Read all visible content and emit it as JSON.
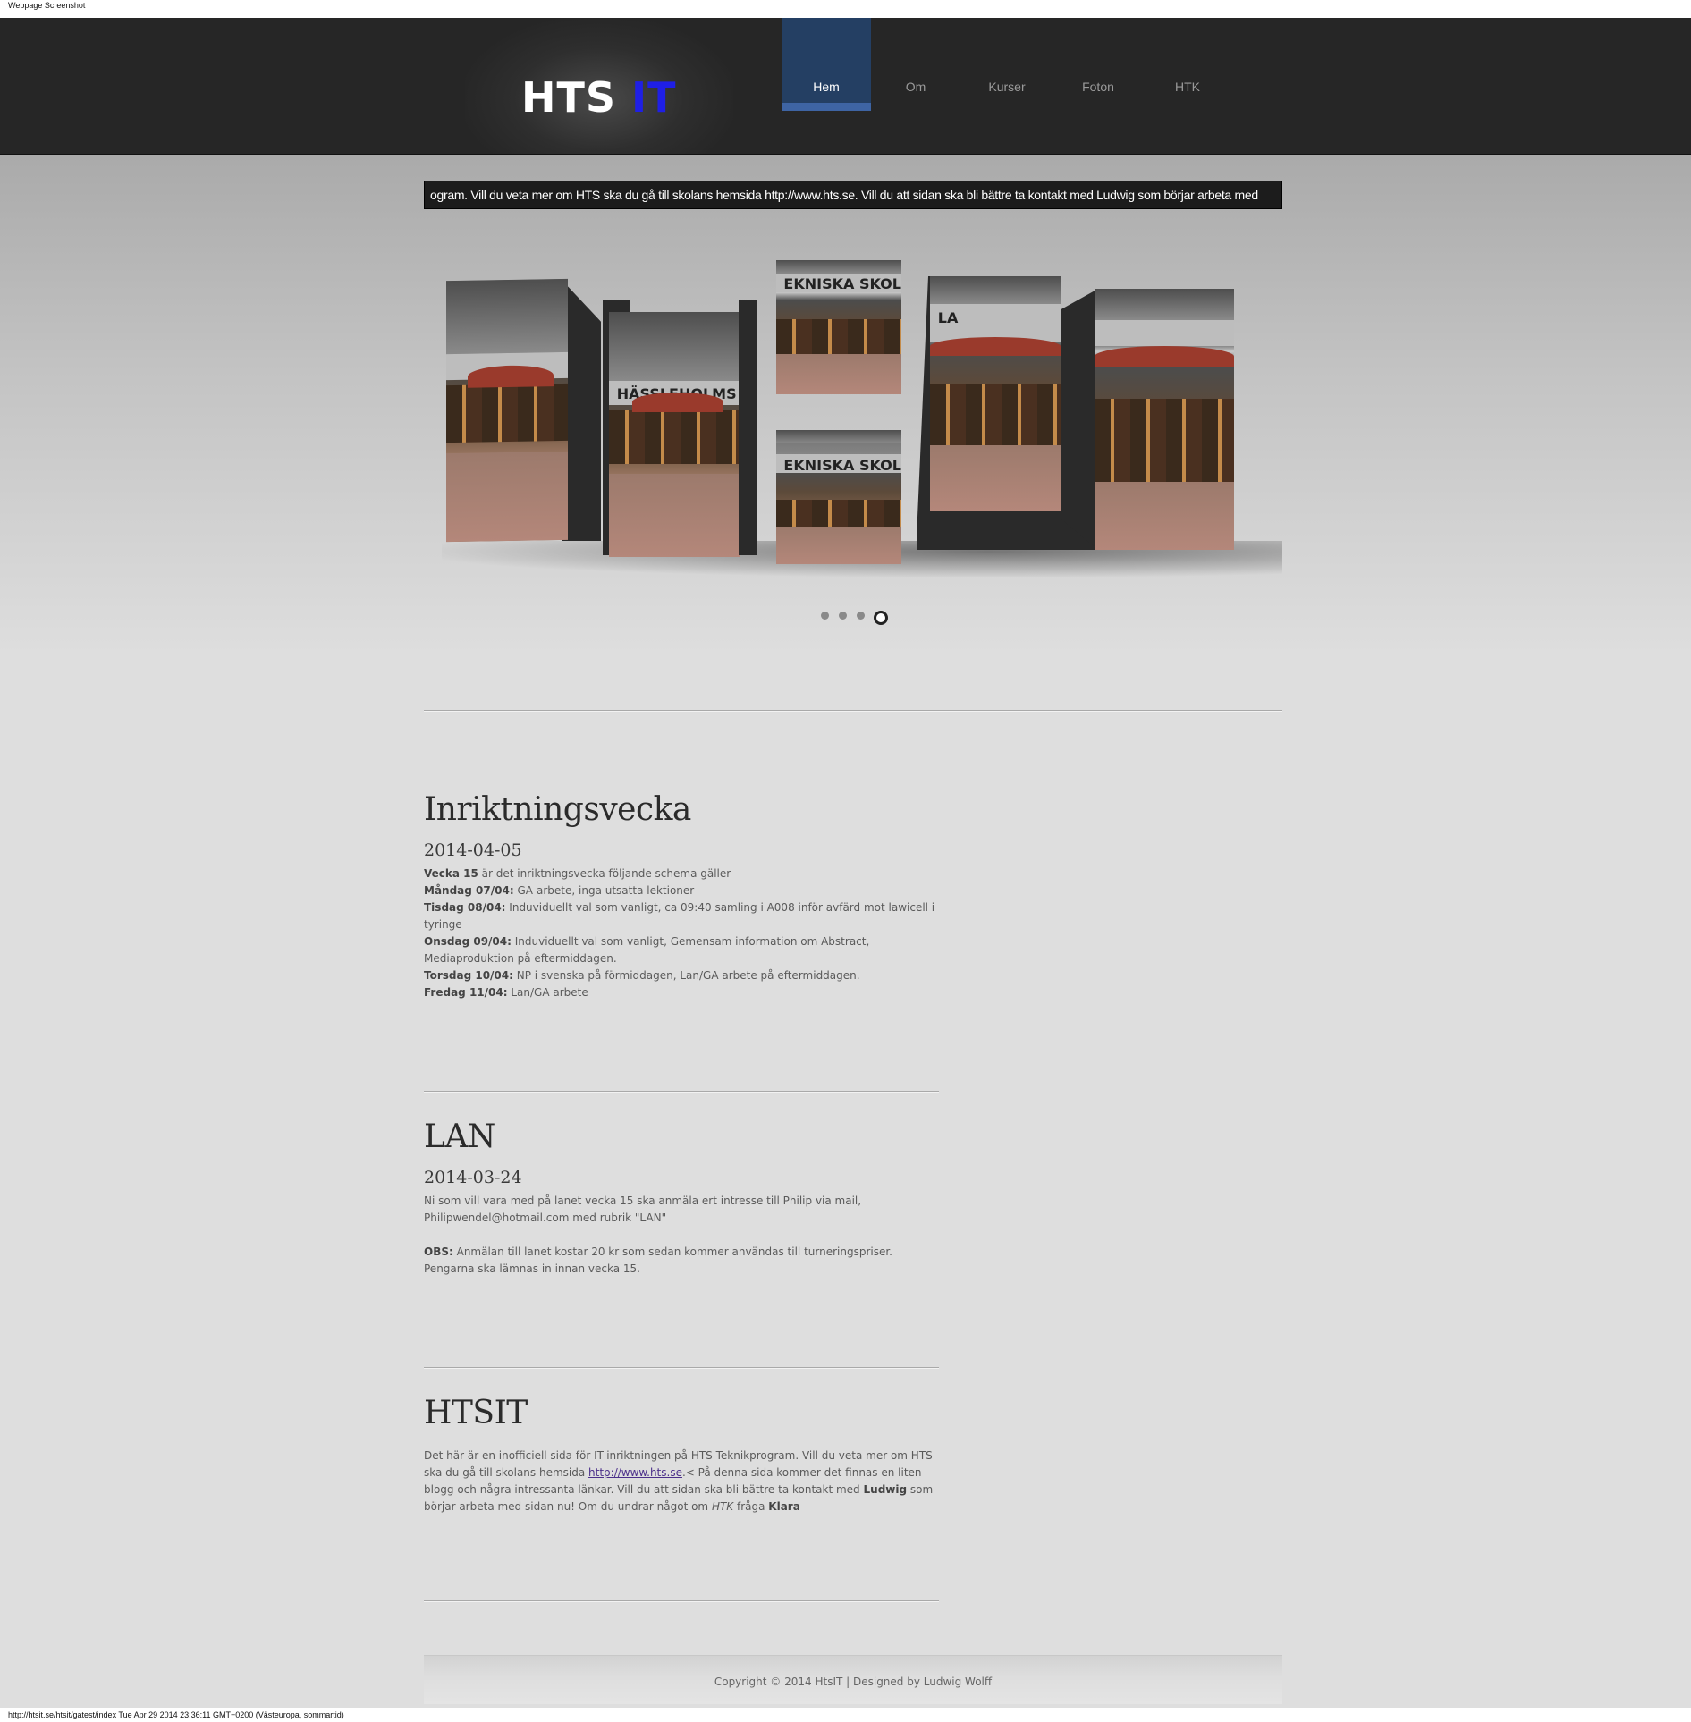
{
  "screenshot": {
    "label": "Webpage Screenshot",
    "status_url": "http://htsit.se/htsit/gatest/index Tue Apr 29 2014 23:36:11 GMT+0200 (Västeuropa, sommartid)"
  },
  "header": {
    "logo_hts": "HTS",
    "logo_it": "IT",
    "nav": [
      {
        "label": "Hem",
        "active": true
      },
      {
        "label": "Om"
      },
      {
        "label": "Kurser"
      },
      {
        "label": "Foton"
      },
      {
        "label": "HTK"
      }
    ]
  },
  "ticker": {
    "text": "ogram. Vill du veta mer om HTS ska du gå till skolans hemsida http://www.hts.se. Vill du att sidan ska bli bättre ta kontakt med Ludwig som börjar arbeta med"
  },
  "slider": {
    "signs": [
      "HÄSSLEHOLMS TE",
      "EKNISKA SKOL",
      "EKNISKA SKOL",
      "LA"
    ],
    "dots": 4,
    "active_dot": 4
  },
  "articles": [
    {
      "title": "Inriktningsvecka",
      "date": "2014-04-05",
      "lines": [
        {
          "b": "Vecka 15",
          "t": " är det inriktningsvecka följande schema gäller"
        },
        {
          "b": "Måndag 07/04:",
          "t": " GA-arbete, inga utsatta lektioner"
        },
        {
          "b": "Tisdag 08/04:",
          "t": " Induviduellt val som vanligt, ca 09:40 samling i A008 inför avfärd mot lawicell i tyringe"
        },
        {
          "b": "Onsdag 09/04:",
          "t": " Induviduellt val som vanligt, Gemensam information om Abstract, Mediaproduktion på eftermiddagen."
        },
        {
          "b": "Torsdag 10/04:",
          "t": " NP i svenska på förmiddagen, Lan/GA arbete på eftermiddagen."
        },
        {
          "b": "Fredag 11/04:",
          "t": " Lan/GA arbete"
        }
      ]
    },
    {
      "title": "LAN",
      "date": "2014-03-24",
      "p1": "Ni som vill vara med på lanet vecka 15 ska anmäla ert intresse till Philip via mail, Philipwendel@hotmail.com med rubrik \"LAN\"",
      "obs_label": "OBS:",
      "p2": " Anmälan till lanet kostar 20 kr som sedan kommer användas till turneringspriser. Pengarna ska lämnas in innan vecka 15."
    },
    {
      "title": "HTSIT",
      "t1": "Det här är en inofficiell sida för IT-inriktningen på HTS Teknikprogram. Vill du veta mer om HTS ska du gå till skolans hemsida ",
      "link": "http://www.hts.se",
      "t2": ".< På denna sida kommer det finnas en liten blogg och några intressanta länkar. Vill du att sidan ska bli bättre ta kontakt med ",
      "b1": "Ludwig",
      "t3": " som börjar arbeta med sidan nu! Om du undrar något om ",
      "i1": "HTK",
      "t4": " fråga ",
      "b2": "Klara"
    }
  ],
  "footer": {
    "text": "Copyright © 2014 HtsIT | Designed by Ludwig Wolff"
  }
}
